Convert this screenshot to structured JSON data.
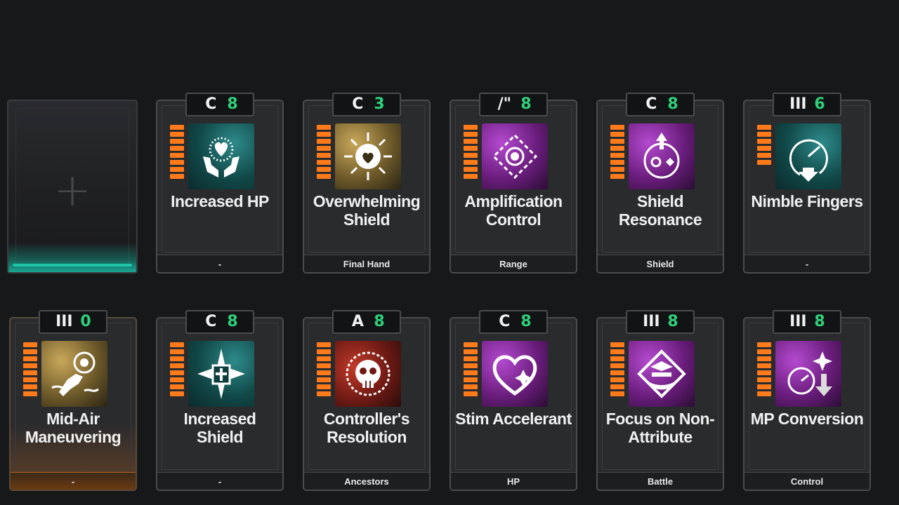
{
  "cards": [
    {
      "name": "Increased HP",
      "tag": "-",
      "symbol": "C",
      "cost": "8",
      "icon": "heart-hands-icon",
      "color": "teal"
    },
    {
      "name": "Overwhelming Shield",
      "tag": "Final Hand",
      "symbol": "C",
      "cost": "3",
      "icon": "radiant-heart-shield-icon",
      "color": "gold"
    },
    {
      "name": "Amplification Control",
      "tag": "Range",
      "symbol": "/\"",
      "cost": "8",
      "icon": "diamond-target-icon",
      "color": "purple"
    },
    {
      "name": "Shield Resonance",
      "tag": "Shield",
      "symbol": "C",
      "cost": "8",
      "icon": "circular-resonance-icon",
      "color": "purple"
    },
    {
      "name": "Nimble Fingers",
      "tag": "-",
      "symbol": "III",
      "cost": "6",
      "icon": "clock-arrow-icon",
      "color": "teal"
    },
    {
      "name": "Mid-Air Maneuvering",
      "tag": "-",
      "symbol": "III",
      "cost": "0",
      "icon": "grappling-hand-icon",
      "color": "gold",
      "highlight": true
    },
    {
      "name": "Increased Shield",
      "tag": "-",
      "symbol": "C",
      "cost": "8",
      "icon": "cross-shield-icon",
      "color": "teal"
    },
    {
      "name": "Controller's Resolution",
      "tag": "Ancestors",
      "symbol": "A",
      "cost": "8",
      "icon": "skull-gear-icon",
      "color": "red"
    },
    {
      "name": "Stim Accelerant",
      "tag": "HP",
      "symbol": "C",
      "cost": "8",
      "icon": "heart-outline-icon",
      "color": "purple"
    },
    {
      "name": "Focus on Non-Attribute",
      "tag": "Battle",
      "symbol": "III",
      "cost": "8",
      "icon": "diamond-focus-icon",
      "color": "purple"
    },
    {
      "name": "MP Conversion",
      "tag": "Control",
      "symbol": "III",
      "cost": "8",
      "icon": "clock-down-arrow-icon",
      "color": "purple"
    }
  ],
  "empty_slot": {
    "icon": "plus-icon"
  }
}
